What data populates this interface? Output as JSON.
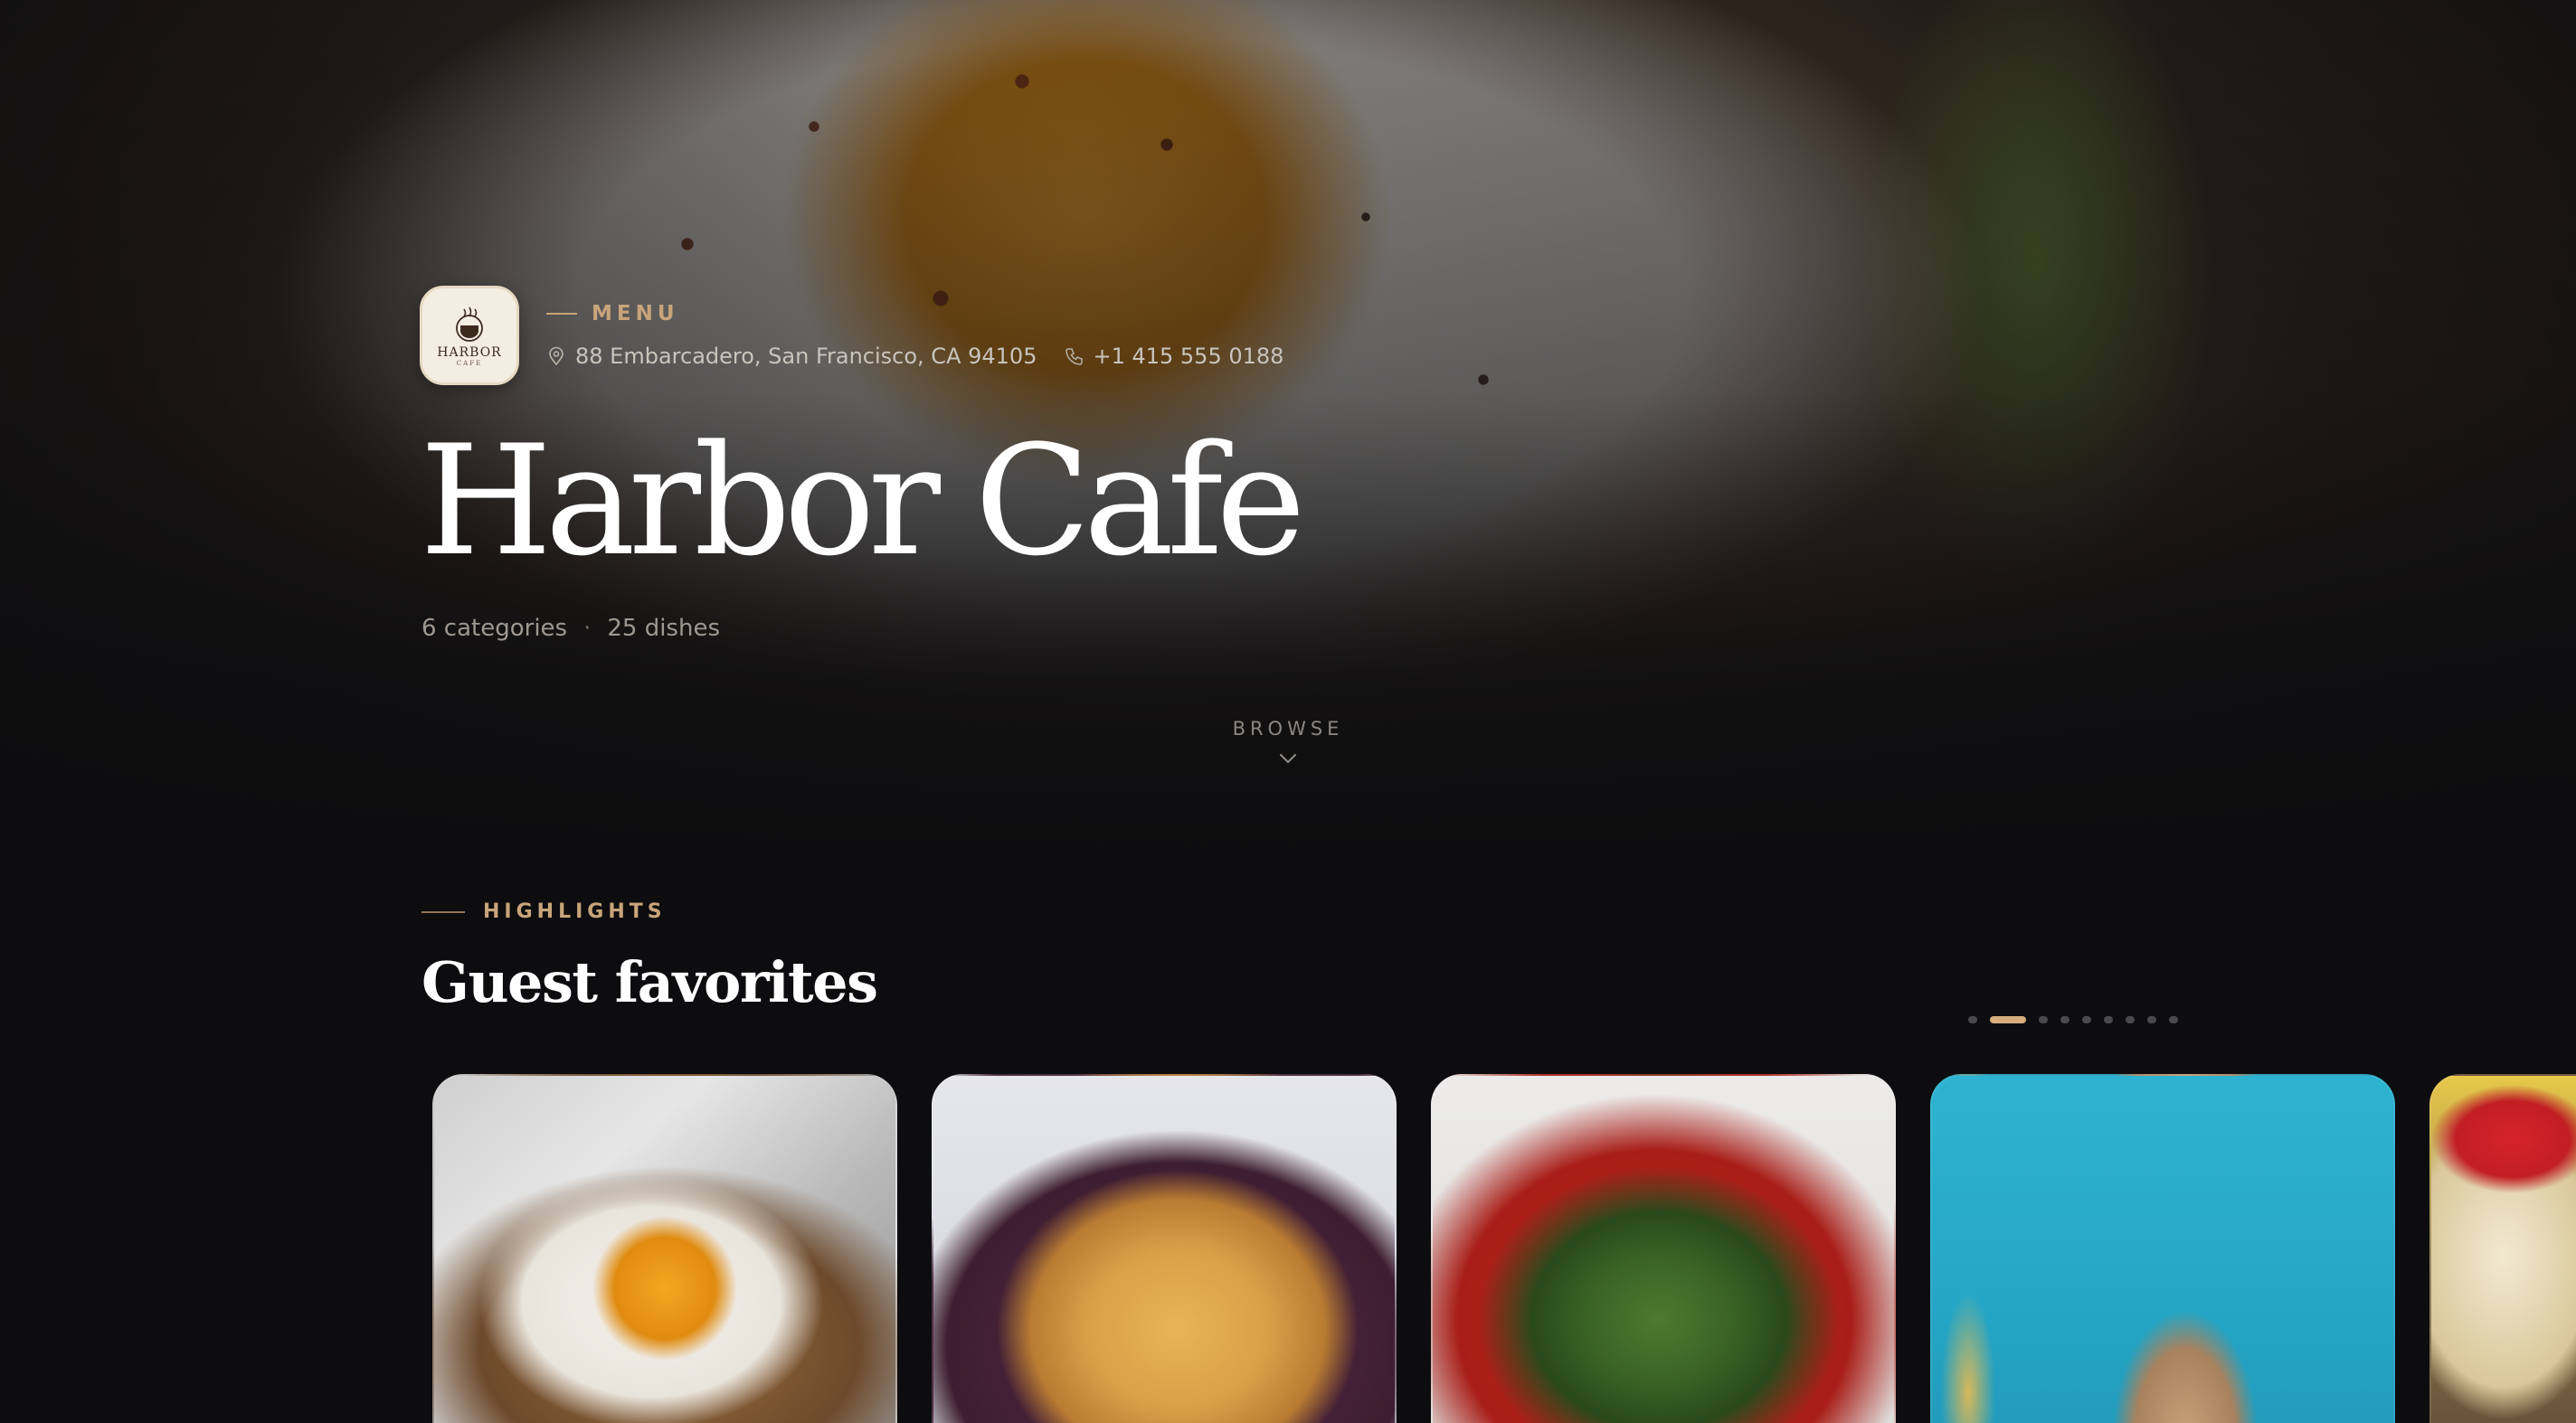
{
  "hero": {
    "logo_text": "HARBOR",
    "logo_subtext": "CAFE",
    "section_label": "MENU",
    "address": "88 Embarcadero, San Francisco, CA 94105",
    "phone": "+1 415 555 0188",
    "title": "Harbor Cafe",
    "categories": "6 categories",
    "stats_separator": "·",
    "dishes": "25 dishes",
    "browse_label": "BROWSE"
  },
  "highlights": {
    "section_label": "HIGHLIGHTS",
    "title": "Guest favorites",
    "pager": {
      "total": 9,
      "active_index": 1
    },
    "cards": [
      {
        "name": "card-avocado-toast-egg"
      },
      {
        "name": "card-fries"
      },
      {
        "name": "card-green-salad"
      },
      {
        "name": "card-wrap-drink"
      },
      {
        "name": "card-tacos-mineral-water"
      }
    ]
  },
  "colors": {
    "accent": "#c8a47a",
    "pager_active": "#d6ad7e",
    "background": "#0d0d0f"
  },
  "icons": [
    "map-pin-icon",
    "phone-icon",
    "chevron-down-icon",
    "coffee-cup-icon"
  ]
}
